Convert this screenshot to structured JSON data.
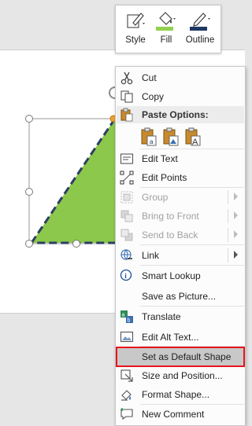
{
  "toolbar": {
    "style_label": "Style",
    "fill_label": "Fill",
    "outline_label": "Outline",
    "fill_color": "#92d050",
    "outline_color": "#1f3864"
  },
  "shape": {
    "fill_color": "#8cc84b",
    "outline_color": "#2d3e63"
  },
  "menu": {
    "cut": "Cut",
    "copy": "Copy",
    "paste_options": "Paste Options:",
    "edit_text": "Edit Text",
    "edit_points": "Edit Points",
    "group": "Group",
    "bring_to_front": "Bring to Front",
    "send_to_back": "Send to Back",
    "link": "Link",
    "smart_lookup": "Smart Lookup",
    "save_as_picture": "Save as Picture...",
    "translate": "Translate",
    "edit_alt_text": "Edit Alt Text...",
    "set_as_default_shape": "Set as Default Shape",
    "size_and_position": "Size and Position...",
    "format_shape": "Format Shape...",
    "new_comment": "New Comment"
  },
  "highlight_color": "#e8141b"
}
